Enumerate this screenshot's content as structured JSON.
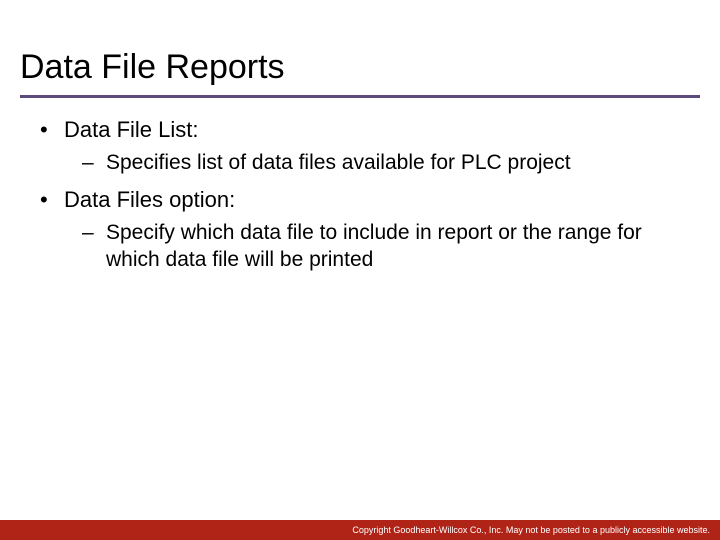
{
  "slide": {
    "title": "Data File Reports",
    "bullets": [
      {
        "text": "Data File List:",
        "sub": [
          "Specifies list of data files available for PLC project"
        ]
      },
      {
        "text": "Data Files option:",
        "sub": [
          "Specify which data file to include in report or the range for which data file will be printed"
        ]
      }
    ],
    "footer": "Copyright Goodheart-Willcox Co., Inc.  May not be posted to a publicly accessible website."
  }
}
